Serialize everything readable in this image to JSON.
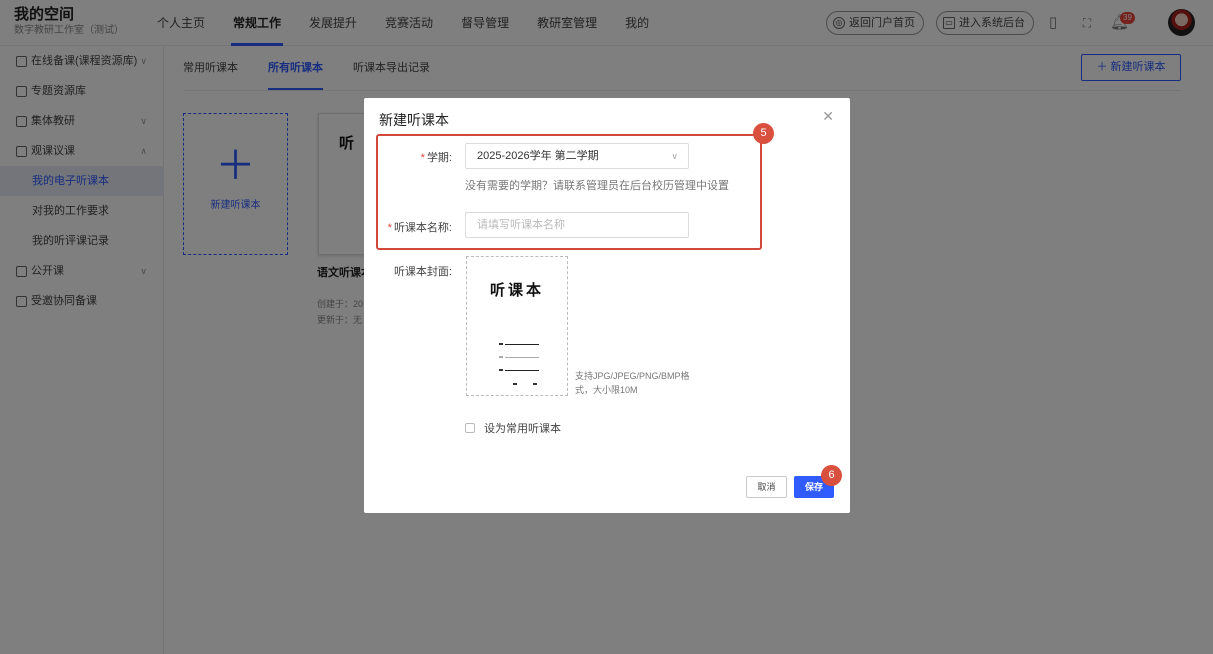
{
  "header": {
    "title": "我的空间",
    "subtitle": "数字教研工作室（测试）",
    "nav": [
      "个人主页",
      "常规工作",
      "发展提升",
      "竞赛活动",
      "督导管理",
      "教研室管理",
      "我的"
    ],
    "active_nav": "常规工作",
    "portal_btn": "返回门户首页",
    "admin_btn": "进入系统后台",
    "bell_count": "39"
  },
  "sidebar": {
    "items": [
      {
        "label": "在线备课(课程资源库)",
        "icon": "doc-icon"
      },
      {
        "label": "专题资源库",
        "icon": "folder-icon"
      },
      {
        "label": "集体教研",
        "icon": "list-icon"
      },
      {
        "label": "观课议课",
        "icon": "observe-icon"
      }
    ],
    "sub": [
      "我的电子听课本",
      "对我的工作要求",
      "我的听评课记录"
    ],
    "items2": [
      {
        "label": "公开课",
        "icon": "screen-icon"
      },
      {
        "label": "受邀协同备课",
        "icon": "team-icon"
      }
    ]
  },
  "main": {
    "tabs": [
      "常用听课本",
      "所有听课本",
      "听课本导出记录"
    ],
    "new_btn": "新建听课本",
    "new_card_label": "新建听课本",
    "book": {
      "cover_title": "听",
      "name": "语文听课本",
      "created": "创建于：20",
      "updated": "更新于：无"
    }
  },
  "modal": {
    "title": "新建听课本",
    "term_label": "学期:",
    "term_value": "2025-2026学年 第二学期",
    "term_hint": "没有需要的学期？请联系管理员在后台校历管理中设置",
    "name_label": "听课本名称:",
    "name_placeholder": "请填写听课本名称",
    "cover_label": "听课本封面:",
    "cover_title": "听课本",
    "cover_note": "支持JPG/JPEG/PNG/BMP格式，大小限10M",
    "checkbox_label": "设为常用听课本",
    "cancel": "取消",
    "save": "保存",
    "step5": "5",
    "step6": "6"
  },
  "colors": {
    "primary": "#2f5bff",
    "highlight": "#d4483c",
    "badge": "#d9503f"
  }
}
